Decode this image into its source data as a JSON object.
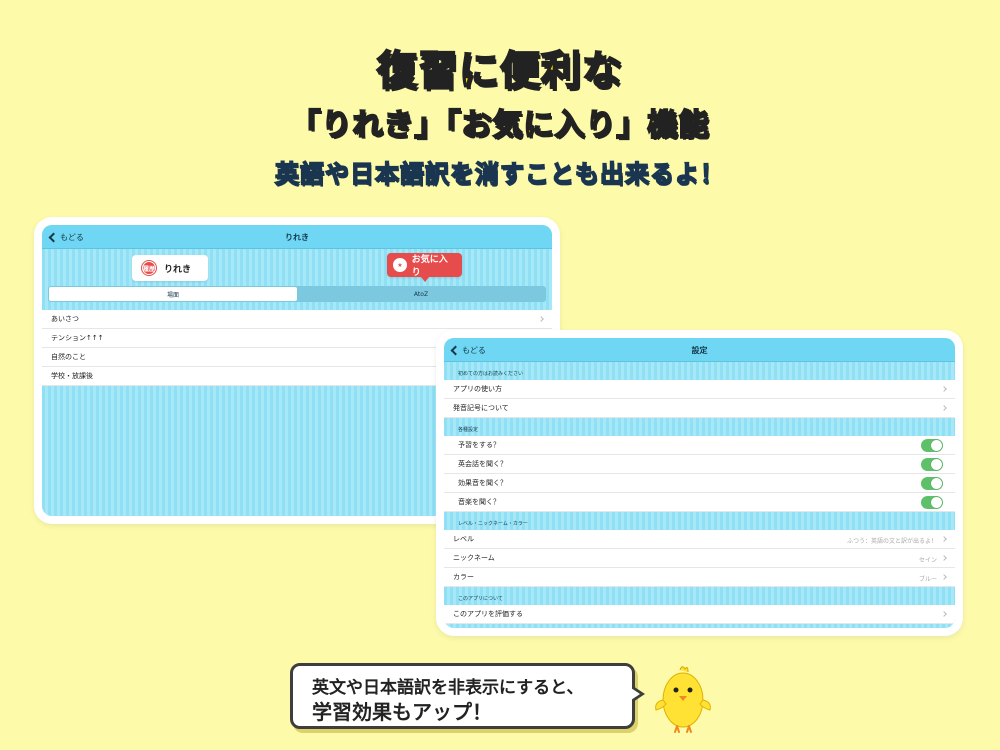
{
  "headline": {
    "line1": "復習に便利な",
    "line2": "「りれき」「お気に入り」機能",
    "line3": "英語や日本語訳を消すことも出来るよ！"
  },
  "history_screen": {
    "back_label": "もどる",
    "title": "りれき",
    "chip_history_icon": "履歴",
    "chip_history_label": "りれき",
    "chip_favorite_label": "お気に入り",
    "segments": [
      "場面",
      "AtoZ"
    ],
    "rows": [
      "あいさつ",
      "テンション↑↑↑",
      "自然のこと",
      "学校・放課後"
    ]
  },
  "settings_screen": {
    "back_label": "もどる",
    "title": "設定",
    "section1_header": "初めての方はお読みください",
    "section1_rows": [
      "アプリの使い方",
      "発音記号について"
    ],
    "section2_header": "各種設定",
    "toggles": [
      {
        "label": "予習をする？",
        "state": "on"
      },
      {
        "label": "英会話を聞く？",
        "state": "on"
      },
      {
        "label": "効果音を聞く？",
        "state": "on"
      },
      {
        "label": "音楽を聞く？",
        "state": "on"
      }
    ],
    "section3_header": "レベル・ニックネーム・カラー",
    "value_rows": [
      {
        "label": "レベル",
        "value": "ふつう：英語の文と訳が出るよ！"
      },
      {
        "label": "ニックネーム",
        "value": "セイン"
      },
      {
        "label": "カラー",
        "value": "ブルー"
      }
    ],
    "section4_header": "このアプリについて",
    "section4_rows": [
      "このアプリを評価する"
    ]
  },
  "callout": {
    "line1": "英文や日本語訳を非表示にすると、",
    "line2": "学習効果もアップ！"
  },
  "colors": {
    "background": "#fdfbaa",
    "navbar": "#6fd6f3",
    "toggle_on": "#5ec16a",
    "favorite_red": "#e74c4c",
    "title_yellow": "#ffe600",
    "subtitle_cyan": "#3fc7e8"
  },
  "icons": {
    "back": "chevron-left-icon",
    "favorite": "star-icon",
    "history": "history-badge-icon",
    "row": "chevron-right-icon",
    "mascot": "chick-mascot"
  }
}
